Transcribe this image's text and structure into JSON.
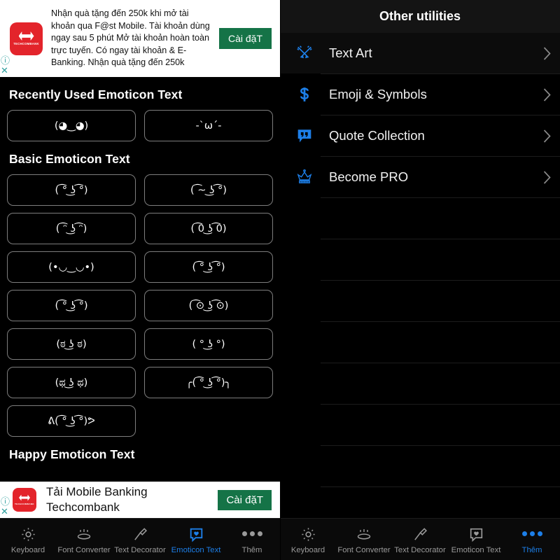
{
  "left": {
    "ad_top": {
      "logo_brand": "TECHCOMBANK",
      "text": "Nhận quà tặng đến 250k khi mở tài khoản qua F@st Mobile. Tài khoản dùng ngay sau 5 phút Mở tài khoản hoàn toàn trực tuyến. Có ngay tài khoản & E-Banking. Nhận quà tặng đến 250k",
      "cta_label": "Cài đặT",
      "info_icon": "info-circle-icon",
      "close_icon": "close-icon",
      "cta_color": "#157347",
      "logo_color": "#e3242b"
    },
    "sections": [
      {
        "title": "Recently Used Emoticon Text",
        "items": [
          "(◕‿◕)",
          "-`ω´-"
        ]
      },
      {
        "title": "Basic Emoticon Text",
        "items": [
          "( ͡° ͜ʖ ͡°)",
          "( ͡~ ͜ʖ ͡°)",
          "( ͡ᵔ ͜ʖ ͡ᵔ)",
          "( ͡0 ͜ʖ ͡0)",
          "(•◡‿◡•)",
          "( ͡° ͜ʖ ͡°)",
          "( ͡° ͜ʖ ͡°)",
          "( ͡⊙ ͜ʖ ͡⊙)",
          "(ಠ ͜ʖ ಠ)",
          "( ° ͜ʖ °)",
          "(ಥ ͜ʖ ಥ)",
          "╭( ͡° ͜ʖ ͡°)╮",
          "ᕕ( ͡° ͜ʖ ͡°)ᕗ"
        ]
      },
      {
        "title": "Happy Emoticon Text",
        "items": []
      }
    ],
    "ad_bottom": {
      "logo_brand": "TECHCOMBANK",
      "line1": "Tải Mobile Banking",
      "line2": "Techcombank",
      "cta_label": "Cài đặT",
      "info_icon": "info-circle-icon",
      "close_icon": "close-icon"
    },
    "navbar": {
      "items": [
        {
          "label": "Keyboard",
          "icon": "gear-icon",
          "active": false
        },
        {
          "label": "Font Converter",
          "icon": "font-converter-icon",
          "active": false
        },
        {
          "label": "Text Decorator",
          "icon": "paint-roller-icon",
          "active": false
        },
        {
          "label": "Emoticon Text",
          "icon": "heart-chat-icon",
          "active": true
        },
        {
          "label": "Thêm",
          "icon": "more-dots-icon",
          "active": false
        }
      ]
    }
  },
  "right": {
    "header_title": "Other utilities",
    "accent_color": "#1d7fe8",
    "items": [
      {
        "label": "Text Art",
        "icon": "crossed-pens-icon",
        "chevron": "chevron-right-icon"
      },
      {
        "label": "Emoji & Symbols",
        "icon": "dollar-sign-icon",
        "chevron": "chevron-right-icon"
      },
      {
        "label": "Quote Collection",
        "icon": "quote-bubble-icon",
        "chevron": "chevron-right-icon"
      },
      {
        "label": "Become PRO",
        "icon": "crown-icon",
        "chevron": "chevron-right-icon"
      }
    ],
    "navbar": {
      "items": [
        {
          "label": "Keyboard",
          "icon": "gear-icon",
          "active": false
        },
        {
          "label": "Font Converter",
          "icon": "font-converter-icon",
          "active": false
        },
        {
          "label": "Text Decorator",
          "icon": "paint-roller-icon",
          "active": false
        },
        {
          "label": "Emoticon Text",
          "icon": "heart-chat-icon",
          "active": false
        },
        {
          "label": "Thêm",
          "icon": "more-dots-icon",
          "active": true
        }
      ]
    }
  }
}
